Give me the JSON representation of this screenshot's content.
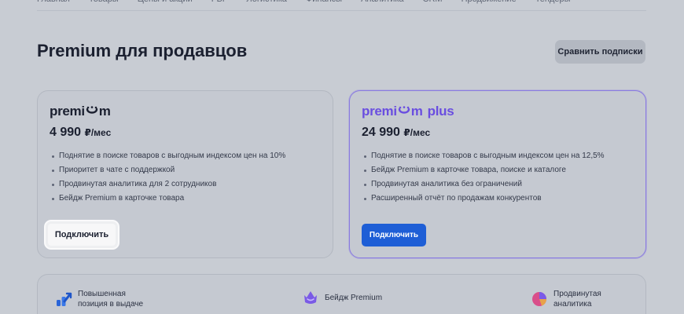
{
  "nav": {
    "items": [
      "Главная",
      "Товары",
      "Цены и акции",
      "FBF",
      "Логистика",
      "Финансы",
      "Аналитика",
      "CRM",
      "Продвижение",
      "Тендеры"
    ]
  },
  "page": {
    "title": "Premium для продавцов",
    "compare_label": "Сравнить подписки"
  },
  "plans": [
    {
      "logo_left": "premi",
      "logo_right": "m",
      "logo_suffix": "",
      "price": "4 990",
      "price_unit": "₽/мес",
      "features": [
        "Поднятие в поиске товаров с выгодным индексом цен на 10%",
        "Приоритет в чате с поддержкой",
        "Продвинутая аналитика для 2 сотрудников",
        "Бейдж Premium в карточке товара"
      ],
      "button_label": "Подключить"
    },
    {
      "logo_left": "premi",
      "logo_right": "m",
      "logo_suffix": "plus",
      "price": "24 990",
      "price_unit": "₽/мес",
      "features": [
        "Поднятие в поиске товаров с выгодным индексом цен на 12,5%",
        "Бейдж Premium в карточке товара, поиске и каталоге",
        "Продвинутая аналитика без ограничений",
        "Расширенный отчёт по продажам конкурентов"
      ],
      "button_label": "Подключить"
    }
  ],
  "benefits": [
    {
      "label": "Повышенная\nпозиция в выдаче",
      "icon": "chart-up-icon"
    },
    {
      "label": "Бейдж Premium",
      "icon": "premium-badge-icon"
    },
    {
      "label": "Продвинутая\nаналитика",
      "icon": "analytics-icon"
    }
  ],
  "colors": {
    "accent_blue": "#1e5ed6",
    "plus_purple": "#6a4ee0",
    "overlay_bg": "#c8ccd3"
  }
}
